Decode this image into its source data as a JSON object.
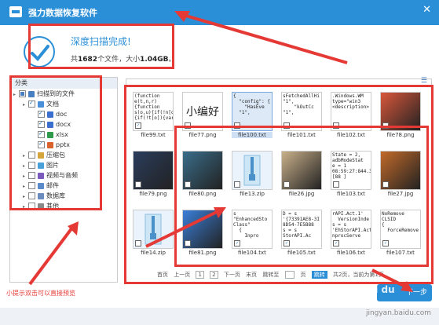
{
  "app": {
    "title": "强力数据恢复软件",
    "close_glyph": "✕"
  },
  "summary": {
    "headline": "深度扫描完成!",
    "prefix": "共",
    "count": "1682",
    "mid": "个文件，大小",
    "size": "1.04GB",
    "suffix": "。"
  },
  "sidebar": {
    "header": "分类",
    "items": [
      {
        "label": "扫描到的文件",
        "level": 0,
        "state": "partial",
        "icon_color": "#4a7fc1",
        "icon": "folder-icon"
      },
      {
        "label": "文档",
        "level": 1,
        "state": "checked",
        "icon_color": "#4a90d9",
        "icon": "doc-icon"
      },
      {
        "label": "doc",
        "level": 2,
        "state": "checked",
        "icon_color": "#3b6fcf",
        "icon": "doc-icon"
      },
      {
        "label": "docx",
        "level": 2,
        "state": "checked",
        "icon_color": "#3b6fcf",
        "icon": "docx-icon"
      },
      {
        "label": "xlsx",
        "level": 2,
        "state": "checked",
        "icon_color": "#2e9a4a",
        "icon": "xlsx-icon"
      },
      {
        "label": "pptx",
        "level": 2,
        "state": "checked",
        "icon_color": "#d9622b",
        "icon": "pptx-icon"
      },
      {
        "label": "压缩包",
        "level": 1,
        "state": "unchecked",
        "icon_color": "#d4a53a",
        "icon": "zip-icon"
      },
      {
        "label": "图片",
        "level": 1,
        "state": "unchecked",
        "icon_color": "#4aa0d9",
        "icon": "image-icon"
      },
      {
        "label": "视频与音频",
        "level": 1,
        "state": "unchecked",
        "icon_color": "#7a5bbd",
        "icon": "media-icon"
      },
      {
        "label": "邮件",
        "level": 1,
        "state": "unchecked",
        "icon_color": "#5a8ac9",
        "icon": "mail-icon"
      },
      {
        "label": "数据库",
        "level": 1,
        "state": "unchecked",
        "icon_color": "#6b8bbf",
        "icon": "database-icon"
      },
      {
        "label": "其他",
        "level": 1,
        "state": "unchecked",
        "icon_color": "#888888",
        "icon": "other-icon"
      }
    ]
  },
  "files": [
    {
      "name": "file99.txt",
      "kind": "text",
      "content": "(function\ne(t,n,r)\n{function\ns(o,u){if(!n[o])\n{if(!t[o]){var",
      "checked": true
    },
    {
      "name": "file77.png",
      "kind": "handwriting",
      "content": "小编好",
      "checked": false
    },
    {
      "name": "file100.txt",
      "kind": "text",
      "content": "{\n  \"config\": {\n    \"HasEve\n  \"1\",",
      "checked": false,
      "selected": true
    },
    {
      "name": "file101.txt",
      "kind": "text",
      "content": "sFetchedAllHi\n\"1\",\n    \"kOutCc\n\"1\",",
      "checked": false
    },
    {
      "name": "file102.txt",
      "kind": "text",
      "content": ".Windows.WM\ntype=\"win3\n<description>",
      "checked": false
    },
    {
      "name": "file78.png",
      "kind": "image",
      "color": "#d9573a",
      "checked": false
    },
    {
      "name": "file79.png",
      "kind": "image",
      "color": "#2a3d5c",
      "checked": false
    },
    {
      "name": "file80.png",
      "kind": "image",
      "color": "#3a6d8a",
      "checked": false
    },
    {
      "name": "file13.zip",
      "kind": "zip",
      "checked": false
    },
    {
      "name": "file26.jpg",
      "kind": "image",
      "color": "#c9b08a",
      "checked": false
    },
    {
      "name": "file103.txt",
      "kind": "text",
      "content": "State = 2,\nadbModeStat\ne = 1\n08:59:27:844.3\n[88 ]",
      "checked": false
    },
    {
      "name": "file27.jpg",
      "kind": "image",
      "color": "#c26a2a",
      "checked": false
    },
    {
      "name": "file14.zip",
      "kind": "zip",
      "checked": false
    },
    {
      "name": "file81.png",
      "kind": "image",
      "color": "#3a7fd9",
      "checked": false
    },
    {
      "name": "file104.txt",
      "kind": "text",
      "content": "s\n\"EnhancedSto\nClass\"\n  {\n    Inpro",
      "checked": true
    },
    {
      "name": "file105.txt",
      "kind": "text",
      "content": "D = s\n'{73391AE8-3I\n8D54-7E5B88\ns = s\nStorAPI.Ac",
      "checked": true
    },
    {
      "name": "file106.txt",
      "kind": "text",
      "content": "rAPI.Act.1'\n  VersionInde\ns = s\n'EhStorAPI.Act\nnprocServe",
      "checked": true
    },
    {
      "name": "file107.txt",
      "kind": "text",
      "content": "NoRemove\nCLSID\n{\n  ForceRemove",
      "checked": true
    }
  ],
  "pager": {
    "first": "首页",
    "prev": "上一页",
    "pages": [
      "1",
      "2"
    ],
    "next": "下一页",
    "last": "末页",
    "jump": "跳转至",
    "page_unit": "页",
    "go": "跳转",
    "info": "共2页，当前为第1页"
  },
  "hint": "小提示双击可以直接预览",
  "next_button": "下一步",
  "watermark": "jingyan.baidu.com",
  "watermark2": "Bai du"
}
